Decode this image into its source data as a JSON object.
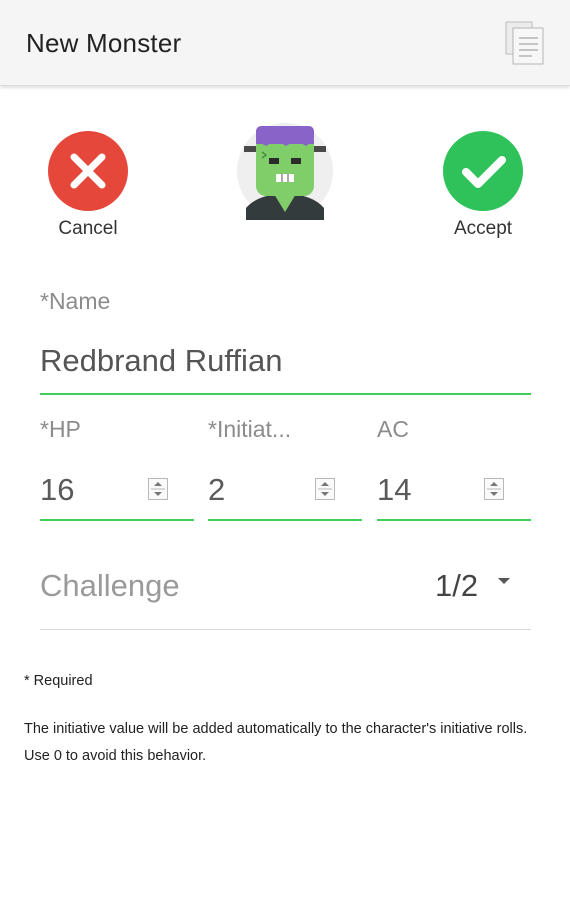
{
  "header": {
    "title": "New Monster",
    "menu_icon": "document-icon"
  },
  "actions": {
    "cancel": {
      "label": "Cancel",
      "icon": "close-icon",
      "color": "#e5473a"
    },
    "accept": {
      "label": "Accept",
      "icon": "check-icon",
      "color": "#2fc25a"
    }
  },
  "avatar": {
    "icon": "frankenstein-monster-icon"
  },
  "form": {
    "name": {
      "label": "*Name",
      "value": "Redbrand Ruffian"
    },
    "hp": {
      "label": "*HP",
      "value": "16"
    },
    "initiative": {
      "label": "*Initiat...",
      "value": "2"
    },
    "ac": {
      "label": "AC",
      "value": "14"
    },
    "challenge": {
      "label": "Challenge",
      "value": "1/2"
    }
  },
  "notes": {
    "required": "* Required",
    "initiative": "The initiative value will be added automatically to the character's initiative rolls. Use 0 to avoid this behavior."
  },
  "colors": {
    "accent_underline": "#3fcf5a",
    "appbar_bg": "#f5f5f5"
  }
}
